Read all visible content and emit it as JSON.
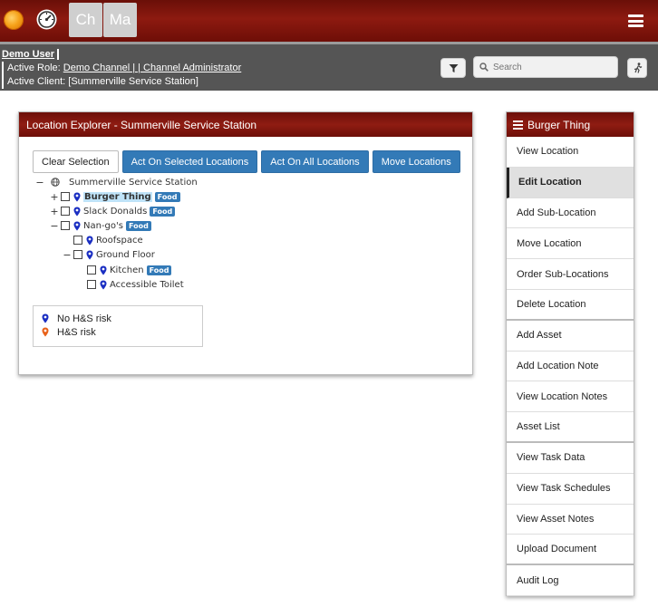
{
  "topbar": {
    "tiles": [
      "Ch",
      "Ma"
    ]
  },
  "userbar": {
    "user_name": "Demo User",
    "role_label": "Active Role:",
    "role_value": "Demo Channel | | Channel Administrator",
    "client_label": "Active Client:",
    "client_value": "[Summerville Service Station]",
    "search_placeholder": "Search"
  },
  "explorer": {
    "title": "Location Explorer - Summerville Service Station",
    "buttons": {
      "clear": "Clear Selection",
      "act_selected": "Act On Selected Locations",
      "act_all": "Act On All Locations",
      "move": "Move Locations"
    },
    "tree": [
      {
        "toggle": "−",
        "label": "Summerville Service Station",
        "badge": ""
      },
      {
        "toggle": "+",
        "label": "Burger Thing",
        "badge": "Food",
        "selected": true
      },
      {
        "toggle": "+",
        "label": "Slack Donalds",
        "badge": "Food"
      },
      {
        "toggle": "−",
        "label": "Nan-go's",
        "badge": "Food"
      },
      {
        "toggle": "",
        "label": "Roofspace",
        "badge": ""
      },
      {
        "toggle": "−",
        "label": "Ground Floor",
        "badge": ""
      },
      {
        "toggle": "",
        "label": "Kitchen",
        "badge": "Food"
      },
      {
        "toggle": "",
        "label": "Accessible Toilet",
        "badge": ""
      }
    ],
    "legend": {
      "no_risk": "No H&S risk",
      "risk": "H&S risk"
    }
  },
  "menu": {
    "title": "Burger Thing",
    "items": [
      "View Location",
      "Edit Location",
      "Add Sub-Location",
      "Move Location",
      "Order Sub-Locations",
      "Delete Location",
      "Add Asset",
      "Add Location Note",
      "View Location Notes",
      "Asset List",
      "View Task Data",
      "View Task Schedules",
      "View Asset Notes",
      "Upload Document",
      "Audit Log"
    ]
  },
  "colors": {
    "header_red": "#8d1a10",
    "button_blue": "#337ab7",
    "pin_blue": "#1a2ec2",
    "pin_orange": "#e8621a"
  }
}
